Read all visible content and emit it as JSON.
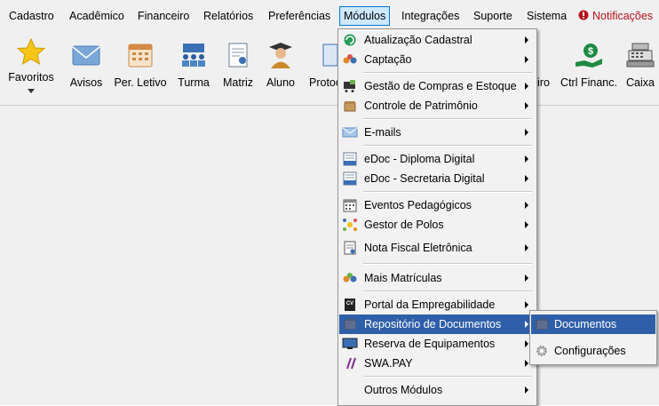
{
  "menubar": {
    "items": [
      {
        "label": "Cadastro"
      },
      {
        "label": "Acadêmico"
      },
      {
        "label": "Financeiro"
      },
      {
        "label": "Relatórios"
      },
      {
        "label": "Preferências"
      },
      {
        "label": "Módulos",
        "active": true
      },
      {
        "label": "Integrações"
      },
      {
        "label": "Suporte"
      },
      {
        "label": "Sistema"
      }
    ],
    "notifications_label": "Notificações",
    "notifications_color": "#b5121b",
    "active_bg": "#cde8ff",
    "active_border": "#0078d7"
  },
  "toolbar": {
    "buttons": [
      {
        "label": "Favoritos",
        "icon": "star-icon"
      },
      {
        "label": "Avisos",
        "icon": "envelope-icon"
      },
      {
        "label": "Per. Letivo",
        "icon": "calendar-icon"
      },
      {
        "label": "Turma",
        "icon": "class-group-icon"
      },
      {
        "label": "Matriz",
        "icon": "certificate-icon"
      },
      {
        "label": "Aluno",
        "icon": "student-icon"
      },
      {
        "label": "Protoc",
        "icon": "protocol-icon"
      },
      {
        "label": "iro",
        "icon": ""
      },
      {
        "label": "Ctrl Financ.",
        "icon": "money-hand-icon"
      },
      {
        "label": "Caixa",
        "icon": "cash-register-icon"
      }
    ]
  },
  "modules_menu": {
    "highlight_color": "#2f5fa9",
    "items": [
      {
        "label": "Atualização Cadastral",
        "icon": "refresh-icon",
        "submenu": true
      },
      {
        "label": "Captação",
        "icon": "people-icon",
        "submenu": true
      },
      {
        "label": "Gestão de Compras e Estoque",
        "icon": "cart-icon",
        "submenu": true
      },
      {
        "label": "Controle de Patrimônio",
        "icon": "box-icon",
        "submenu": true
      },
      {
        "label": "E-mails",
        "icon": "email-icon",
        "submenu": true
      },
      {
        "label": "eDoc - Diploma Digital",
        "icon": "edoc-icon",
        "submenu": true
      },
      {
        "label": "eDoc - Secretaria Digital",
        "icon": "edoc-icon",
        "submenu": true
      },
      {
        "label": "Eventos Pedagógicos",
        "icon": "calendar-icon",
        "submenu": true
      },
      {
        "label": "Gestor de Polos",
        "icon": "hub-icon",
        "submenu": true
      },
      {
        "label": "Nota Fiscal Eletrônica",
        "icon": "invoice-icon",
        "submenu": true
      },
      {
        "label": "Mais Matrículas",
        "icon": "people-icon",
        "submenu": true
      },
      {
        "label": "Portal da Empregabilidade",
        "icon": "cv-icon",
        "submenu": true
      },
      {
        "label": "Repositório de Documentos",
        "icon": "folder-icon",
        "submenu": true,
        "highlighted": true
      },
      {
        "label": "Reserva de Equipamentos",
        "icon": "monitor-icon",
        "submenu": true
      },
      {
        "label": "SWA.PAY",
        "icon": "slash-icon",
        "submenu": true
      },
      {
        "label": "Outros Módulos",
        "icon": "",
        "submenu": true
      }
    ]
  },
  "submenu": {
    "items": [
      {
        "label": "Documentos",
        "icon": "folder-icon",
        "highlighted": true
      },
      {
        "label": "Configurações",
        "icon": "gear-icon"
      }
    ]
  }
}
